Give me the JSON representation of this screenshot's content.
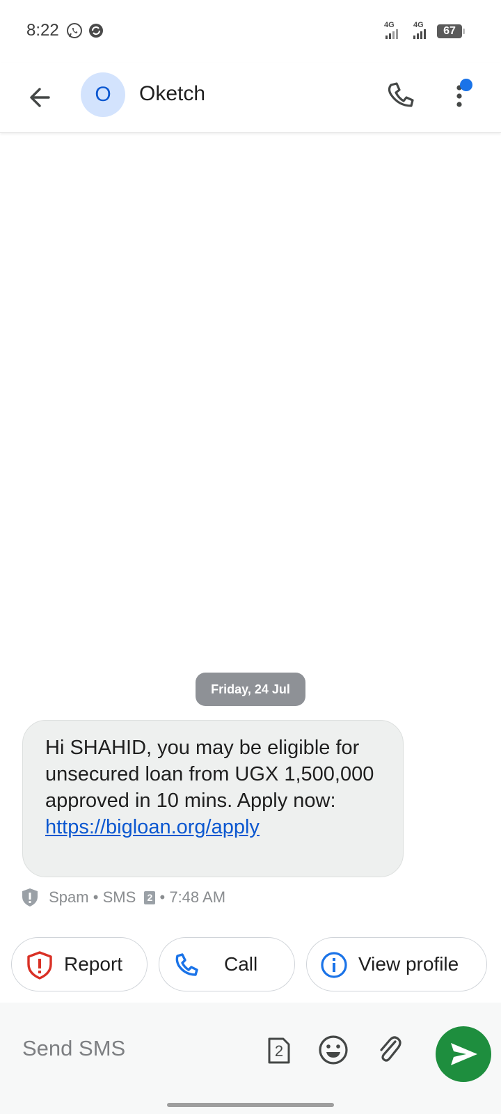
{
  "status_bar": {
    "time": "8:22",
    "icons": [
      "whatsapp-icon",
      "sync-icon",
      "signal-4g-icon",
      "signal-4g-icon",
      "battery-icon"
    ],
    "network_1": "4G",
    "network_2": "4G",
    "battery": "67"
  },
  "header": {
    "contact_initial": "O",
    "contact_name": "Oketch",
    "icons": [
      "back-arrow-icon",
      "phone-icon",
      "more-vert-icon",
      "notification-dot"
    ],
    "accent_color": "#0b57d0"
  },
  "conversation": {
    "date_chip": "Friday, 24 Jul",
    "message": {
      "text": "Hi SHAHID, you may be eligible for unsecured loan from UGX 1,500,000 approved in 10 mins. Apply now:",
      "link": "https://bigloan.org/apply",
      "meta_label": "Spam",
      "meta_channel": "SMS",
      "sim": "2",
      "time": "7:48 AM"
    }
  },
  "actions": [
    {
      "label": "Report",
      "icon": "report-shield-icon"
    },
    {
      "label": "Call",
      "icon": "phone-icon"
    },
    {
      "label": "View profile",
      "icon": "info-icon"
    }
  ],
  "compose": {
    "placeholder": "Send SMS",
    "sim": "2",
    "icons": [
      "sim-2-icon",
      "emoji-icon",
      "attach-icon",
      "send-icon"
    ],
    "send_color": "#1e8e3e"
  }
}
